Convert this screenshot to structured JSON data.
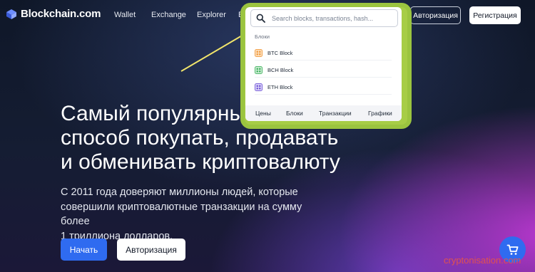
{
  "brand": {
    "name": "Blockchain.com"
  },
  "nav": {
    "links": [
      "Wallet",
      "Exchange",
      "Explorer",
      "E"
    ],
    "login_label": "Авторизация",
    "register_label": "Регистрация"
  },
  "search": {
    "placeholder": "Search blocks, transactions, hash...",
    "section_label": "Блоки",
    "items": [
      {
        "label": "BTC Block",
        "icon": "btc-block-icon",
        "color": "#f2a14a"
      },
      {
        "label": "BCH Block",
        "icon": "bch-block-icon",
        "color": "#4fb86b"
      },
      {
        "label": "ETH Block",
        "icon": "eth-block-icon",
        "color": "#7b62d9"
      }
    ],
    "tabs": [
      "Цены",
      "Блоки",
      "Транзакции",
      "Графики"
    ]
  },
  "hero": {
    "headline_lines": [
      "Самый популярный",
      "способ покупать, продавать",
      "и обменивать криптовалюту"
    ],
    "subtext_lines": [
      "С 2011 года доверяют миллионы людей, которые",
      "совершили криптовалютные транзакции на сумму более",
      "1 триллиона долларов."
    ],
    "start_label": "Начать",
    "auth_label": "Авторизация"
  },
  "watermark": "cryptonisation.com",
  "colors": {
    "accent": "#2f6bf0",
    "highlight": "#9bc43f",
    "arrow": "#f2e56b",
    "watermark": "#e05151"
  }
}
